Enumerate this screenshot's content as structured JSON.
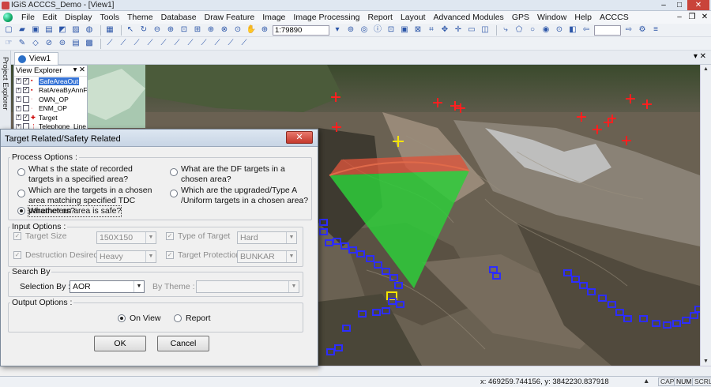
{
  "window": {
    "title": "IGiS  ACCCS_Demo - [View1]"
  },
  "menu": [
    "File",
    "Edit",
    "Display",
    "Tools",
    "Theme",
    "Database",
    "Draw Feature",
    "Image",
    "Image Processing",
    "Report",
    "Layout",
    "Advanced Modules",
    "GPS",
    "Window",
    "Help",
    "ACCCS"
  ],
  "toolbar": {
    "scale_value": "1:79890"
  },
  "side_panel_label": "Project Explorer",
  "view_tab": "View1",
  "view_explorer": {
    "title": "View Explorer",
    "layers": [
      {
        "name": "SafeAreaOut",
        "checked": true,
        "selected": true
      },
      {
        "name": "RatAreaByAnnFl",
        "checked": true,
        "selected": false
      },
      {
        "name": "OWN_OP",
        "checked": false,
        "selected": false
      },
      {
        "name": "ENM_OP",
        "checked": false,
        "selected": false
      },
      {
        "name": "Target",
        "checked": true,
        "selected": false
      },
      {
        "name": "Telephone_Line",
        "checked": false,
        "selected": false
      }
    ]
  },
  "dialog": {
    "title": "Target Related/Safety Related",
    "close": "✕",
    "process_options": {
      "legend": "Process Options :",
      "options": [
        "What s the state of recorded targets in a specified area?",
        "What are the DF targets in a chosen area?",
        "Which are the targets in a chosen area matching specified TDC parameters?",
        "Which are the upgraded/Type A /Uniform targets in a chosen area?",
        "Whether an area is safe?"
      ],
      "selected_index": 4
    },
    "input_options": {
      "legend": "Input Options :",
      "target_size_label": "Target Size",
      "target_size_value": "150X150",
      "type_of_target_label": "Type of Target",
      "type_of_target_value": "Hard",
      "destruction_label": "Destruction Desired",
      "destruction_value": "Heavy",
      "target_protection_label": "Target Protection",
      "target_protection_value": "BUNKAR"
    },
    "search_by": {
      "legend": "Search By",
      "selection_label": "Selection By :",
      "selection_value": "AOR",
      "by_theme_label": "By Theme :",
      "by_theme_value": ""
    },
    "output_options": {
      "legend": "Output Options :",
      "on_view": "On View",
      "report": "Report",
      "selected": "On View"
    },
    "ok": "OK",
    "cancel": "Cancel"
  },
  "status": {
    "coords": "x: 469259.744156,   y: 3842230.837918",
    "cap": "CAP",
    "num": "NUM",
    "scrl": "SCRL"
  },
  "colors": {
    "safe_sector": "#2ecc3a",
    "danger_ring": "#d9553c",
    "targets_red": "#ff2020",
    "targets_blue": "#2d2dff",
    "marker_yellow": "#f5e500"
  }
}
